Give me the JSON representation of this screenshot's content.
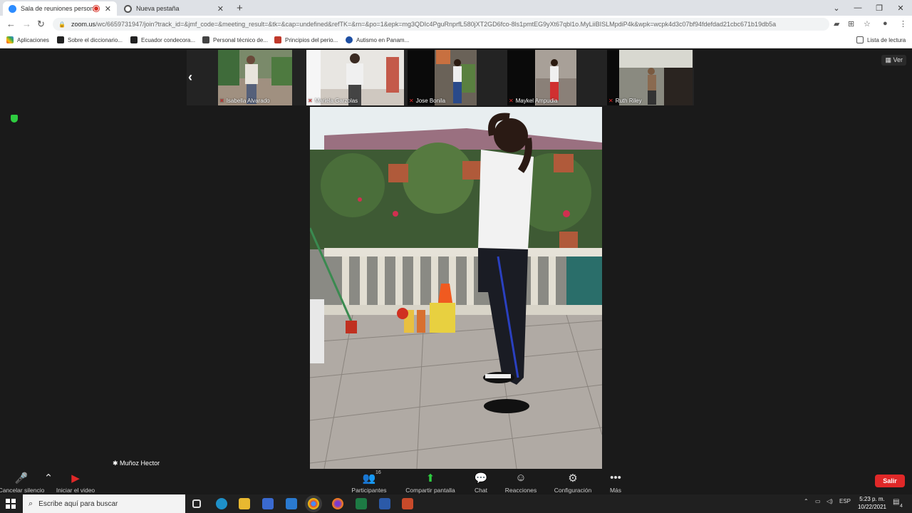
{
  "browser": {
    "tabs": [
      {
        "title": "Sala de reuniones personal",
        "active": true
      },
      {
        "title": "Nueva pestaña",
        "active": false
      }
    ],
    "url_domain": "zoom.us",
    "url_path": "/wc/6659731947/join?track_id=&jmf_code=&meeting_result=&tk=&cap=undefined&refTK=&rn=&po=1&epk=mg3QDIc4PguRnprfL580jXT2GD6fco-8ls1pmtEG9yXt67qbl1o.MyLiiBISLMpdiP4k&wpk=wcpk4d3c07bf94fdefdad21cbc671b19db5a",
    "bookmarks": [
      "Aplicaciones",
      "Sobre el diccionario...",
      "Ecuador condecora...",
      "Personal técnico de...",
      "Principios del perio...",
      "Autismo en Panam..."
    ],
    "reading_list": "Lista de lectura"
  },
  "meeting": {
    "participants_strip": [
      {
        "name": "Isabella Alvarado"
      },
      {
        "name": "Mariela Garzolas"
      },
      {
        "name": "Jose Bonila"
      },
      {
        "name": "Maykel Ampudia"
      },
      {
        "name": "Ruth Riley"
      }
    ],
    "view_label": "Ver",
    "active_speaker": "Muñoz Hector",
    "participant_count": "16"
  },
  "toolbar": {
    "mute": "Cancelar silencio",
    "video": "Iniciar el video",
    "participants": "Participantes",
    "share": "Compartir pantalla",
    "chat": "Chat",
    "reactions": "Reacciones",
    "settings": "Configuración",
    "more": "Más",
    "leave": "Salir"
  },
  "taskbar": {
    "search_placeholder": "Escribe aquí para buscar",
    "lang": "ESP",
    "time": "5:23 p. m.",
    "date": "10/22/2021",
    "notif_count": "4"
  },
  "colors": {
    "leave": "#e02828",
    "share": "#2ecc40",
    "zoom_bg": "#1a1a1a"
  }
}
